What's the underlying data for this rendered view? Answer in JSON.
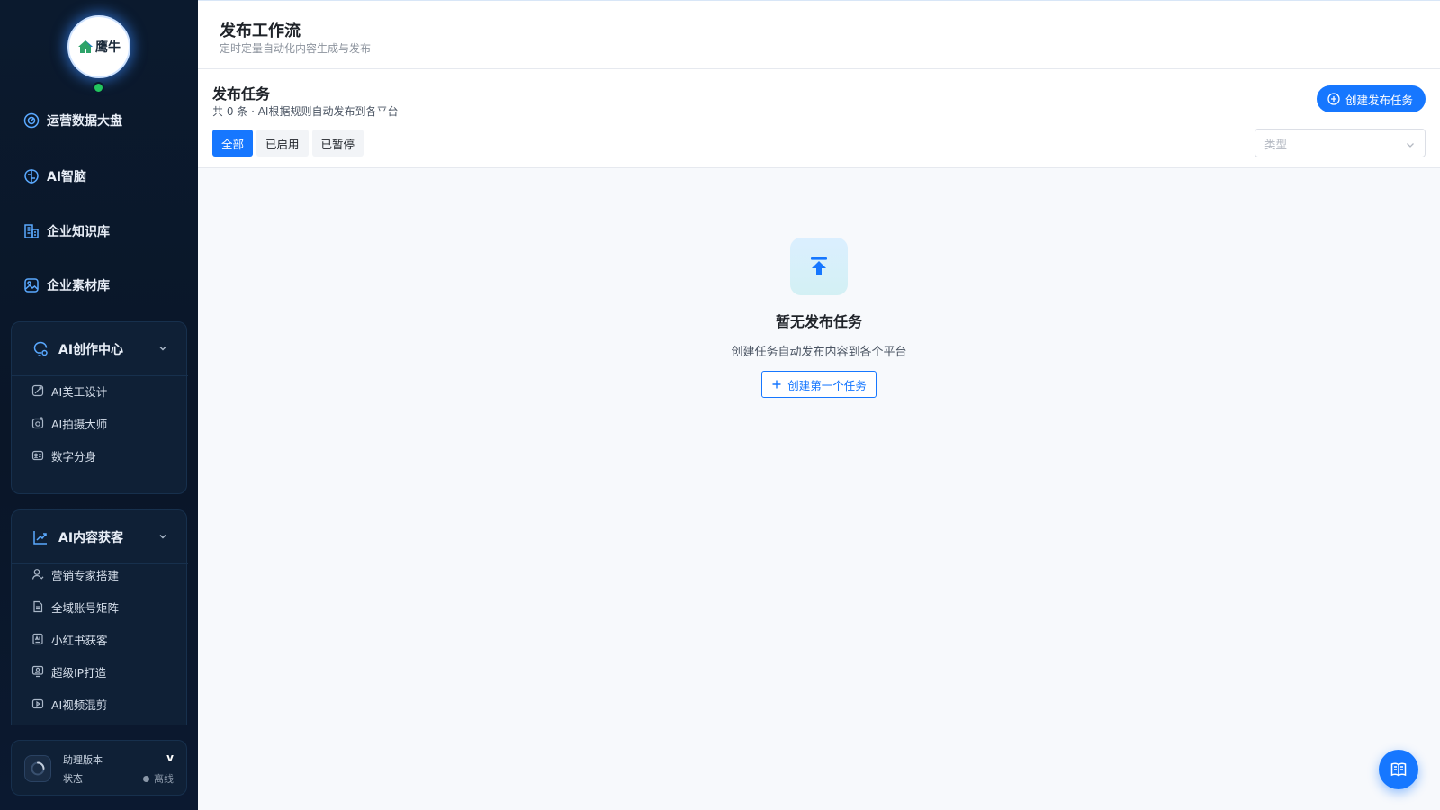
{
  "brand": {
    "logo_text": "鹰牛"
  },
  "sidebar": {
    "items": [
      {
        "label": "运营数据大盘"
      },
      {
        "label": "AI智脑"
      },
      {
        "label": "企业知识库"
      },
      {
        "label": "企业素材库"
      }
    ],
    "groups": [
      {
        "label": "AI创作中心",
        "items": [
          {
            "label": "AI美工设计"
          },
          {
            "label": "AI拍摄大师"
          },
          {
            "label": "数字分身"
          }
        ]
      },
      {
        "label": "AI内容获客",
        "items": [
          {
            "label": "营销专家搭建"
          },
          {
            "label": "全域账号矩阵"
          },
          {
            "label": "小红书获客"
          },
          {
            "label": "超级IP打造"
          },
          {
            "label": "AI视频混剪"
          }
        ]
      }
    ]
  },
  "assistant": {
    "version_label": "助理版本",
    "version_value": "v",
    "status_label": "状态",
    "status_value": "离线"
  },
  "header": {
    "title": "发布工作流",
    "subtitle": "定时定量自动化内容生成与发布"
  },
  "section": {
    "title": "发布任务",
    "subtitle": "共 0 条 · AI根据规则自动发布到各平台",
    "create_label": "创建发布任务",
    "tabs": [
      {
        "label": "全部",
        "active": true
      },
      {
        "label": "已启用"
      },
      {
        "label": "已暂停"
      }
    ],
    "type_placeholder": "类型"
  },
  "empty": {
    "title": "暂无发布任务",
    "description": "创建任务自动发布内容到各个平台",
    "button_label": "创建第一个任务"
  },
  "colors": {
    "primary": "#1677ff",
    "sidebar_bg": "#0b1a2e",
    "online": "#22c55e"
  },
  "icons": {
    "nav": [
      "dashboard-icon",
      "brain-icon",
      "building-icon",
      "image-icon"
    ],
    "fab": "book-icon"
  }
}
